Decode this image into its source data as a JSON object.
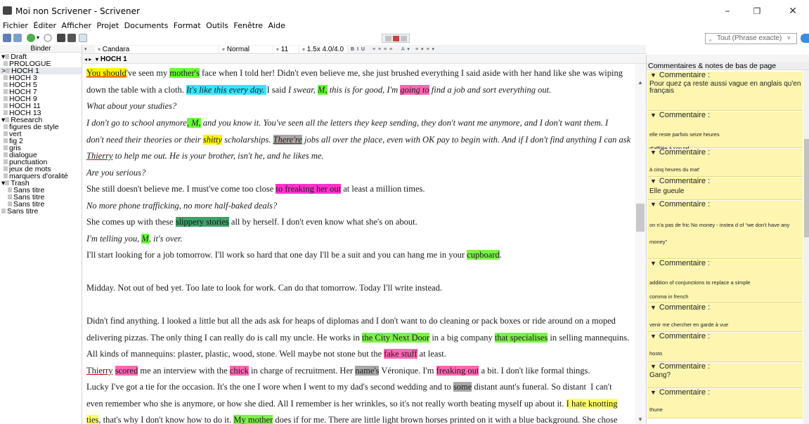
{
  "window": {
    "title": "Moi non Scrivener - Scrivener",
    "minimize": "–",
    "maximize": "❐",
    "close": "✕"
  },
  "menu": [
    "Fichier",
    "Éditer",
    "Afficher",
    "Projet",
    "Documents",
    "Format",
    "Outils",
    "Fenêtre",
    "Aide"
  ],
  "search": {
    "placeholder": "Tout (Phrase exacte)"
  },
  "binder": {
    "header": "Binder",
    "items": [
      {
        "label": "Draft",
        "expander": "▾"
      },
      {
        "label": "PROLOGUE"
      },
      {
        "label": "HOCH 1",
        "expander": ">"
      },
      {
        "label": "HOCH 3"
      },
      {
        "label": "HOCH 5"
      },
      {
        "label": "HOCH 7"
      },
      {
        "label": "HOCH 9"
      },
      {
        "label": "HOCH 11"
      },
      {
        "label": "HOCH 13"
      },
      {
        "label": "Research",
        "expander": "▾"
      },
      {
        "label": "figures de style"
      },
      {
        "label": "vert"
      },
      {
        "label": "fig 2"
      },
      {
        "label": "gris"
      },
      {
        "label": "dialogue"
      },
      {
        "label": "punctuation"
      },
      {
        "label": "jeux de mots"
      },
      {
        "label": "marquers d'oralité"
      },
      {
        "label": "Trash",
        "expander": "▾"
      },
      {
        "label": "Sans titre"
      },
      {
        "label": "Sans titre"
      },
      {
        "label": "Sans titre"
      },
      {
        "label": "Sans titre"
      }
    ]
  },
  "formatbar": {
    "font": "Candara",
    "style": "Normal",
    "size": "11",
    "spacing": "1.5x 4.0/4.0",
    "bold_italic": "B I U",
    "align": "≡ ≡ ≡ ≡",
    "color_tools": "A ▾",
    "list_tools": "≡ ▾ ≡ ▾"
  },
  "header": {
    "nav": "◂ ▸",
    "title": "HOCH 1"
  },
  "editor": {
    "paragraphs": [
      "You should've seen my mother's face when I told her! Didn't even believe me, she just brushed everything I said aside with her hand like she was wiping",
      "down the table with a cloth. It's like this every day. I said I swear, M, this is for good, I'm going to find a job and sort everything out.",
      "What about your studies?",
      "I don't go to school anymore, M, and you know it. You've seen all the letters they keep sending, they don't want me anymore, and I don't want them. I",
      "don't need their theories or their shitty scholarships. There're jobs all over the place, even with OK pay to begin with. And if I don't find anything I can ask",
      "Thierry to help me out. He is your brother, isn't he, and he likes me.",
      "Are you serious?",
      "She still doesn't believe me. I must've come too close to freaking her out at least a million times.",
      "No more phone trafficking, no more half-baked deals?",
      "She comes up with these slippery stories all by herself. I don't even know what she's on about.",
      "I'm telling you, M, it's over.",
      "I'll start looking for a job tomorrow. I'll work so hard that one day I'll be a suit and you can hang me in your cupboard.",
      "Midday. Not out of bed yet. Too late to look for work. Can do that tomorrow. Today I'll write instead.",
      "Didn't find anything. I looked a little but all the ads ask for heaps of diplomas and I don't want to do cleaning or pack boxes or ride around on a moped",
      "delivering pizzas. The only thing I can really do is call my uncle. He works in the City Next Door in a big company that specialises in selling mannequins.",
      "All kinds of mannequins: plaster, plastic, wood, stone. Well maybe not stone but the fake stuff at least.",
      "Thierry scored me an interview with the chick in charge of recruitment. Her name's Véronique. I'm freaking out a bit. I don't like formal things.",
      "Lucky I've got a tie for the occasion. It's the one I wore when I went to my dad's second wedding and to some distant aunt's funeral. So distant  I can't",
      "even remember who she is anymore, or how she died. All I remember is her wrinkles, so it's not really worth beating myself up about it. I hate knotting",
      "ties, that's why I don't know how to do it. My mother does if for me. There are little light brown horses printed on it with a blue background. She chose"
    ]
  },
  "inspector": {
    "title": "Commentaires & notes de bas de page",
    "comment_label": "Commentaire :",
    "comments": [
      {
        "text": "Pour quez ça reste aussi vague en anglais qu'en français"
      },
      {
        "text": "elle reste parfois seize heures d'affilée à son taf"
      },
      {
        "text": "à cinq heures du mat'"
      },
      {
        "text": "Elle gueule"
      },
      {
        "text": "on n'a pas de fric  No money - instea d of “we don't have any money”"
      },
      {
        "text": "addition of conjunctions  to replace a simple comma in french"
      },
      {
        "text": "venir me chercher en garde à vue"
      },
      {
        "text": "hosto"
      },
      {
        "text": "Gang?"
      },
      {
        "text": "thune"
      }
    ]
  },
  "colors": {
    "yellow": "#fff200",
    "green": "#66ff33",
    "cyan": "#33e6ff",
    "pink": "#ff66b3",
    "magenta": "#ff33cc",
    "gray": "#a8a8a8",
    "dark_green": "#3fa06a",
    "comment_bg": "#fdf5b0"
  }
}
